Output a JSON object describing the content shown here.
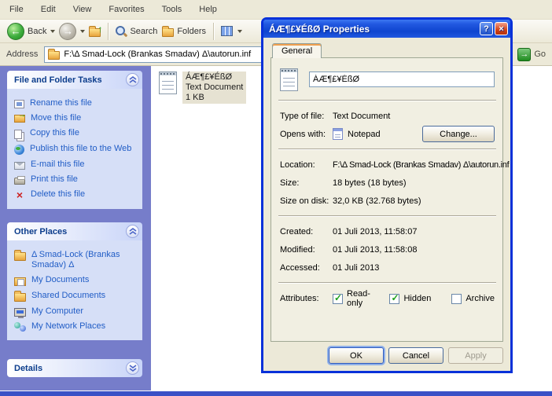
{
  "window": {
    "menu": [
      "File",
      "Edit",
      "View",
      "Favorites",
      "Tools",
      "Help"
    ],
    "toolbar": {
      "back_label": "Back",
      "search_label": "Search",
      "folders_label": "Folders"
    },
    "address": {
      "label": "Address",
      "path": "F:\\Δ Smad-Lock (Brankas Smadav) Δ\\autorun.inf",
      "go_label": "Go"
    }
  },
  "sidebar": {
    "file_tasks": {
      "title": "File and Folder Tasks",
      "items": [
        {
          "label": "Rename this file"
        },
        {
          "label": "Move this file"
        },
        {
          "label": "Copy this file"
        },
        {
          "label": "Publish this file to the Web"
        },
        {
          "label": "E-mail this file"
        },
        {
          "label": "Print this file"
        },
        {
          "label": "Delete this file"
        }
      ]
    },
    "other_places": {
      "title": "Other Places",
      "items": [
        {
          "label": "Δ Smad-Lock (Brankas Smadav) Δ"
        },
        {
          "label": "My Documents"
        },
        {
          "label": "Shared Documents"
        },
        {
          "label": "My Computer"
        },
        {
          "label": "My Network Places"
        }
      ]
    },
    "details": {
      "title": "Details"
    }
  },
  "content": {
    "file": {
      "name": "ÁÆ¶£¥ÉßØ",
      "type": "Text Document",
      "size": "1 KB"
    }
  },
  "dialog": {
    "title": "ÁÆ¶£¥ÉßØ Properties",
    "tab": "General",
    "filename": "ÁÆ¶£¥ÉßØ",
    "fields": {
      "type_label": "Type of file:",
      "type_value": "Text Document",
      "opens_label": "Opens with:",
      "opens_value": "Notepad",
      "change_label": "Change...",
      "location_label": "Location:",
      "location_value": "F:\\Δ Smad-Lock (Brankas Smadav) Δ\\autorun.inf",
      "size_label": "Size:",
      "size_value": "18 bytes (18 bytes)",
      "size_disk_label": "Size on disk:",
      "size_disk_value": "32,0 KB (32.768 bytes)",
      "created_label": "Created:",
      "created_value": "01 Juli 2013, 11:58:07",
      "modified_label": "Modified:",
      "modified_value": "01 Juli 2013, 11:58:08",
      "accessed_label": "Accessed:",
      "accessed_value": "01 Juli 2013",
      "attributes_label": "Attributes:",
      "attr_readonly_label": "Read-only",
      "attr_hidden_label": "Hidden",
      "attr_archive_label": "Archive"
    },
    "attributes_state": {
      "readonly": true,
      "hidden": true,
      "archive": false
    },
    "buttons": {
      "ok": "OK",
      "cancel": "Cancel",
      "apply": "Apply"
    },
    "apply_enabled": false,
    "help_glyph": "?",
    "close_glyph": "×"
  },
  "glyphs": {
    "back_arrow": "←",
    "forward_arrow": "→",
    "go_arrow": "→",
    "delete_x": "×"
  },
  "colors": {
    "taskpane_bg": "#767dca",
    "panel_body": "#d6dff7",
    "link_blue": "#215dc6",
    "dialog_bg": "#ece9d8",
    "dialog_border": "#0831d9",
    "titlebar_blue": "#0f45cf",
    "selection_bg": "#e6e2d2",
    "chrome_tan": "#ece9d8"
  }
}
